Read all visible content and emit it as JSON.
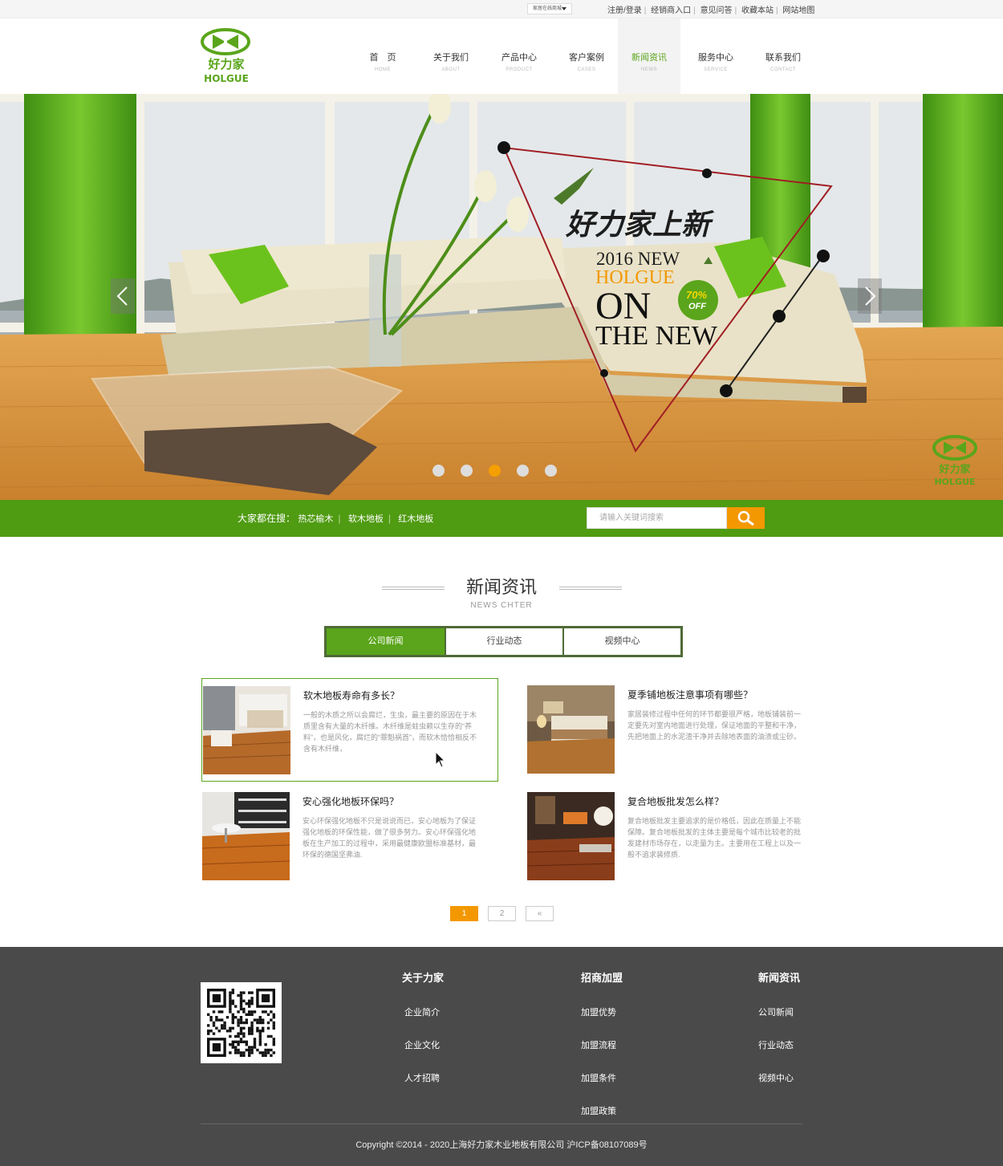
{
  "topbar": {
    "select_label": "家居在线商城",
    "links": [
      "注册/登录",
      "经销商入口",
      "意见问答",
      "收藏本站",
      "网站地图"
    ]
  },
  "logo": {
    "brand_cn": "好力家",
    "brand_en": "HOLGUE"
  },
  "nav": [
    {
      "cn": "首　页",
      "en": "HOME"
    },
    {
      "cn": "关于我们",
      "en": "ABOUT"
    },
    {
      "cn": "产品中心",
      "en": "PRODUCT"
    },
    {
      "cn": "客户案例",
      "en": "CASES"
    },
    {
      "cn": "新闻资讯",
      "en": "NEWS",
      "active": true
    },
    {
      "cn": "服务中心",
      "en": "SERVICE"
    },
    {
      "cn": "联系我们",
      "en": "CONTACT"
    }
  ],
  "banner": {
    "headline": "好力家上新",
    "line1": "2016 NEW",
    "line2": "HOLGUE",
    "line3": "ON",
    "line4": "THE NEW",
    "badge_pct": "70%",
    "badge_off": "OFF",
    "active_slide": 3,
    "slides": 5
  },
  "search": {
    "label": "大家都在搜：",
    "keywords": [
      "热芯榆木",
      "软木地板",
      "红木地板"
    ],
    "placeholder": "请输入关键词搜索"
  },
  "news": {
    "title": "新闻资讯",
    "subtitle": "NEWS CHTER",
    "tabs": [
      "公司新闻",
      "行业动态",
      "视频中心"
    ],
    "items": [
      {
        "title": "软木地板寿命有多长？",
        "desc": "一般的木质之所以会腐烂，生虫，最主要的原因在于木质里含有大量的木纤维。木纤维是蛀虫赖以生存的“养料”，也是风化，腐烂的“罪魁祸首”，而软木恰恰相反不含有木纤维，",
        "highlighted": true
      },
      {
        "title": "夏季铺地板注意事项有哪些？",
        "desc": "家居装修过程中任何的环节都要很严格，地板铺装前一定要先对室内地面进行处理，保证地面的平整和干净，先把地面上的水泥渣干净并去除地表面的油渍或尘砂。"
      },
      {
        "title": "安心强化地板环保吗？",
        "desc": "安心环保强化地板不只是说说而已，安心地板为了保证强化地板的环保性能，做了很多努力。安心环保强化地板在生产加工的过程中，采用最健康欧盟标准基材，最环保的德国坚弗油."
      },
      {
        "title": "复合地板批发怎么样？",
        "desc": "复合地板批发主要追求的是价格低，因此在质量上不能保障。复合地板批发的主体主要是每个城市比较老的批发建材市场存在，以走量为主。主要用在工程上以及一般不追求装修质."
      }
    ],
    "pager": [
      "1",
      "2",
      "«"
    ],
    "current_page": 1
  },
  "footer": {
    "cols": [
      {
        "heading": "关于力家",
        "links": [
          "企业简介",
          "企业文化",
          "人才招聘"
        ]
      },
      {
        "heading": "招商加盟",
        "links": [
          "加盟优势",
          "加盟流程",
          "加盟条件",
          "加盟政策"
        ]
      },
      {
        "heading": "新闻资讯",
        "links": [
          "公司新闻",
          "行业动态",
          "视频中心"
        ]
      }
    ],
    "copyright": "Copyright ©2014 - 2020上海好力家木业地板有限公司  沪ICP备08107089号"
  },
  "colors": {
    "brand_green": "#5aa51b",
    "strip_green": "#4f9b12",
    "accent_orange": "#f39800",
    "footer_bg": "#4a4a4a"
  },
  "icons": [
    "search-icon",
    "chevron-left-icon",
    "chevron-right-icon",
    "qr-code"
  ]
}
